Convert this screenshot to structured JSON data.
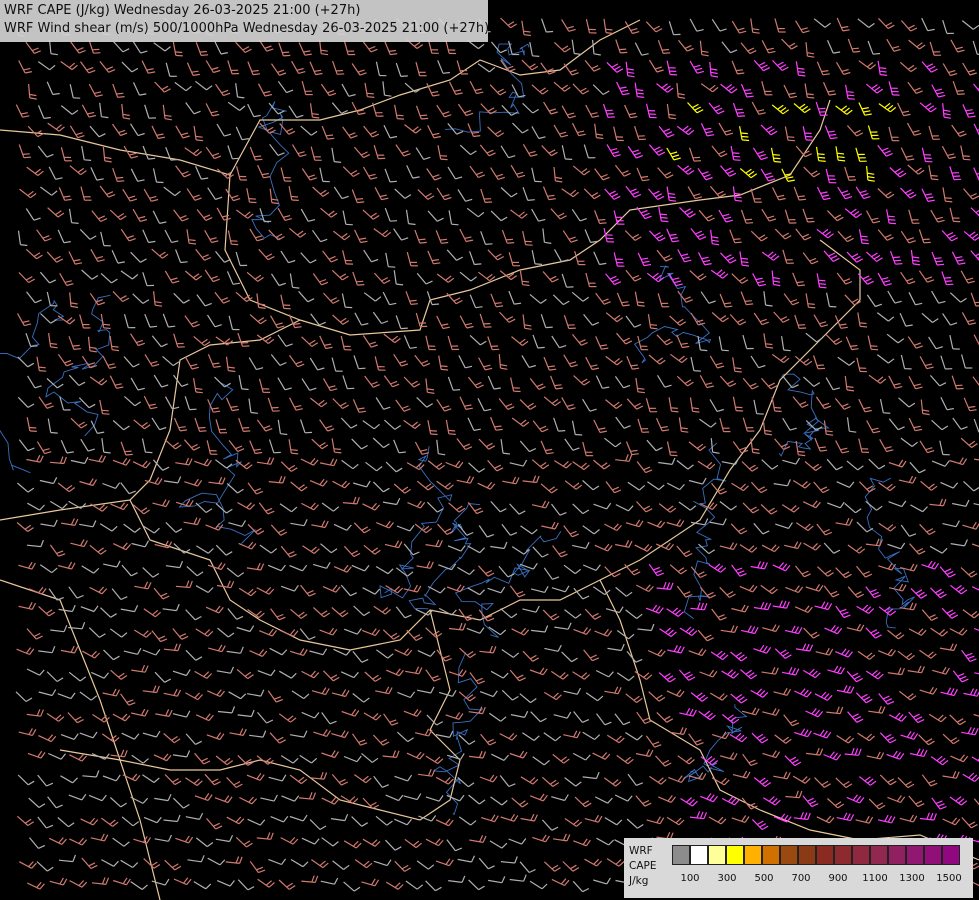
{
  "title": {
    "line1": "WRF CAPE (J/kg) Wednesday 26-03-2025 21:00 (+27h)",
    "line2": "WRF Wind shear (m/s) 500/1000hPa Wednesday 26-03-2025 21:00 (+27h)"
  },
  "legend": {
    "labels": [
      "WRF",
      "CAPE",
      "J/kg"
    ],
    "ticks": [
      "100",
      "300",
      "500",
      "700",
      "900",
      "1100",
      "1300",
      "1500"
    ],
    "colors": [
      "#8c8c8c",
      "#ffffff",
      "#ffff99",
      "#ffff00",
      "#ffb000",
      "#d07000",
      "#9a4a10",
      "#8a3a14",
      "#8a2a20",
      "#8c2a30",
      "#902840",
      "#902850",
      "#902060",
      "#901870",
      "#901078",
      "#900880"
    ]
  },
  "map": {
    "background": "#000000",
    "border_color": "#e8c89a",
    "river_color": "#3a6fc0",
    "barb_colors": {
      "weak": "#b0b0b0",
      "moderate": "#d07a70",
      "strong": "#ff40ff",
      "extreme": "#ffff00"
    }
  }
}
